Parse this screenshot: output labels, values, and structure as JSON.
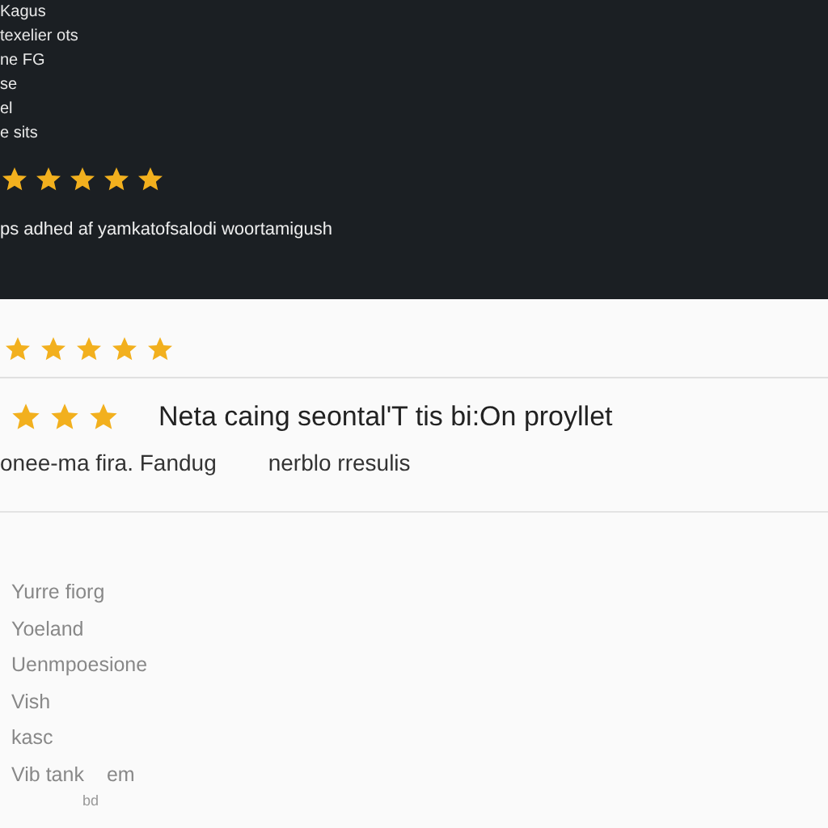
{
  "dark_panel": {
    "lines": [
      "Kagus",
      "texelier ots",
      "ne FG",
      "se",
      "el",
      "e sits"
    ],
    "rating": {
      "stars": 5
    },
    "caption": "ps adhed af yamkatofsalodi woortamigush"
  },
  "review": {
    "top_rating": {
      "stars": 5
    },
    "rating": {
      "stars": 3
    },
    "title": "Neta caing seontal'T tis bi:On proyllet",
    "subtitle": "onee-ma fira. Fandug",
    "subtitle_note": "nerblo rresulis"
  },
  "list": {
    "items": [
      "Yurre fiorg",
      "Yoeland",
      "Uenmpoesione",
      "Vish",
      "kasc",
      "Vib tank"
    ],
    "extra": "em",
    "footnote": "bd"
  }
}
